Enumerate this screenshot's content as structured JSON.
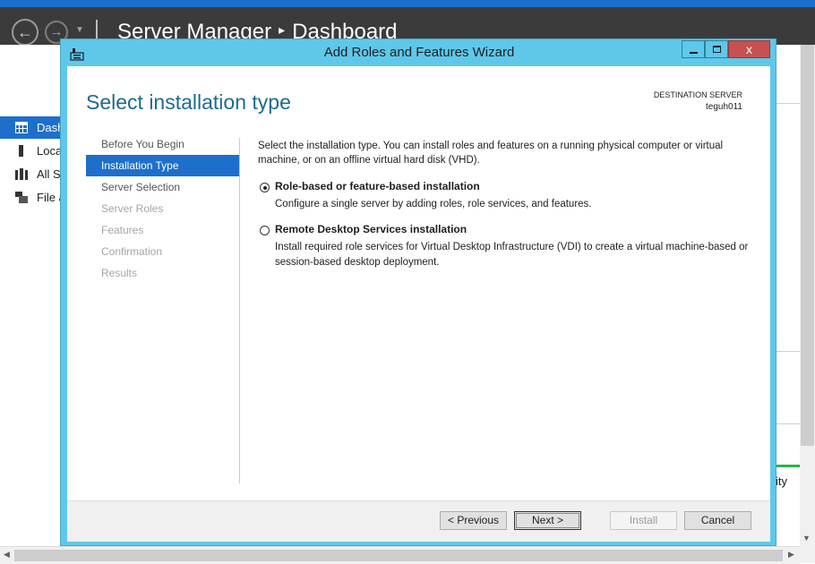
{
  "server_manager": {
    "title": "Server Manager",
    "breadcrumb_separator": "▸",
    "page": "Dashboard",
    "sidebar": [
      {
        "label": "Dashboard",
        "icon": "dashboard-grid-icon"
      },
      {
        "label": "Local Server",
        "icon": "server-icon"
      },
      {
        "label": "All Servers",
        "icon": "servers-icon"
      },
      {
        "label": "File and Storage Services",
        "icon": "file-storage-icon"
      }
    ],
    "right_pane_text": "ity"
  },
  "wizard": {
    "window_title": "Add Roles and Features Wizard",
    "heading": "Select installation type",
    "destination": {
      "label": "DESTINATION SERVER",
      "server": "teguh011"
    },
    "steps": [
      {
        "label": "Before You Begin",
        "state": "normal"
      },
      {
        "label": "Installation Type",
        "state": "active"
      },
      {
        "label": "Server Selection",
        "state": "normal"
      },
      {
        "label": "Server Roles",
        "state": "disabled"
      },
      {
        "label": "Features",
        "state": "disabled"
      },
      {
        "label": "Confirmation",
        "state": "disabled"
      },
      {
        "label": "Results",
        "state": "disabled"
      }
    ],
    "intro": "Select the installation type. You can install roles and features on a running physical computer or virtual machine, or on an offline virtual hard disk (VHD).",
    "options": [
      {
        "title": "Role-based or feature-based installation",
        "description": "Configure a single server by adding roles, role services, and features.",
        "selected": true
      },
      {
        "title": "Remote Desktop Services installation",
        "description": "Install required role services for Virtual Desktop Infrastructure (VDI) to create a virtual machine-based or session-based desktop deployment.",
        "selected": false
      }
    ],
    "buttons": {
      "previous": "< Previous",
      "next": "Next >",
      "install": "Install",
      "cancel": "Cancel"
    },
    "close_glyph": "x"
  }
}
